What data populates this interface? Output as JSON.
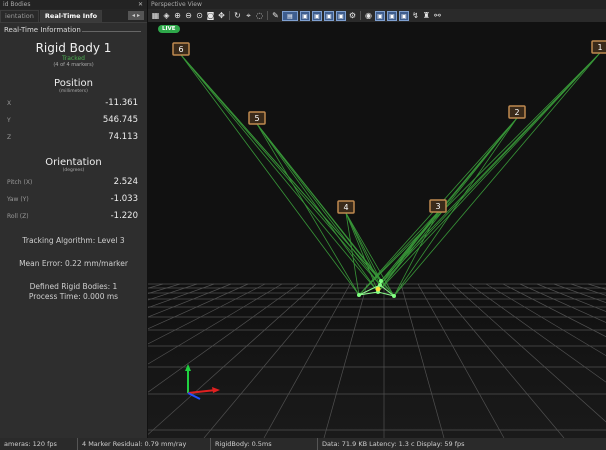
{
  "left_panel": {
    "window_title": "id Bodies",
    "tabs": [
      "ientation",
      "Real-Time Info"
    ],
    "group_title": "Real-Time Information",
    "body_name": "Rigid Body 1",
    "body_status": "Tracked",
    "body_markers": "(4 of 4 markers)",
    "position": {
      "title": "Position",
      "unit": "(millimeters)",
      "rows": [
        {
          "axis": "X",
          "value": "-11.361"
        },
        {
          "axis": "Y",
          "value": "546.745"
        },
        {
          "axis": "Z",
          "value": "74.113"
        }
      ]
    },
    "orientation": {
      "title": "Orientation",
      "unit": "(degrees)",
      "rows": [
        {
          "axis": "Pitch (X)",
          "value": "2.524"
        },
        {
          "axis": "Yaw (Y)",
          "value": "-1.033"
        },
        {
          "axis": "Roll (Z)",
          "value": "-1.220"
        }
      ]
    },
    "tracking_algorithm": "Tracking Algorithm: Level 3",
    "mean_error": "Mean Error: 0.22 mm/marker",
    "defined_bodies": "Defined Rigid Bodies: 1",
    "process_time": "Process Time: 0.000 ms"
  },
  "viewport": {
    "title": "Perspective View",
    "live_badge": "LIVE",
    "cameras": [
      {
        "label": "6"
      },
      {
        "label": "5"
      },
      {
        "label": "4"
      },
      {
        "label": "3"
      },
      {
        "label": "2"
      },
      {
        "label": "1"
      }
    ],
    "toolbar_icons": [
      "grid-icon",
      "camera-cube-icon",
      "zoom-in-icon",
      "zoom-out-icon",
      "zoom-fit-icon",
      "snapshot-icon",
      "pan-icon",
      "rotate-icon",
      "select-icon",
      "marker-icon",
      "brush-icon",
      "LED",
      "view-mode-icon",
      "eye-icon",
      "settings-icon"
    ]
  },
  "status_bar": {
    "items": [
      "ameras: 120 fps",
      "4 Marker Residual: 0.79 mm/ray",
      "RigidBody: 0.5ms",
      "Data: 71.9 KB Latency: 1.3 c Display: 59 fps"
    ]
  },
  "colors": {
    "ray_green": "#3fae3f",
    "grid": "#555555",
    "live_green": "#2ea84a",
    "axis_x": "#e02020",
    "axis_y": "#20d040",
    "axis_z": "#2050ff"
  }
}
